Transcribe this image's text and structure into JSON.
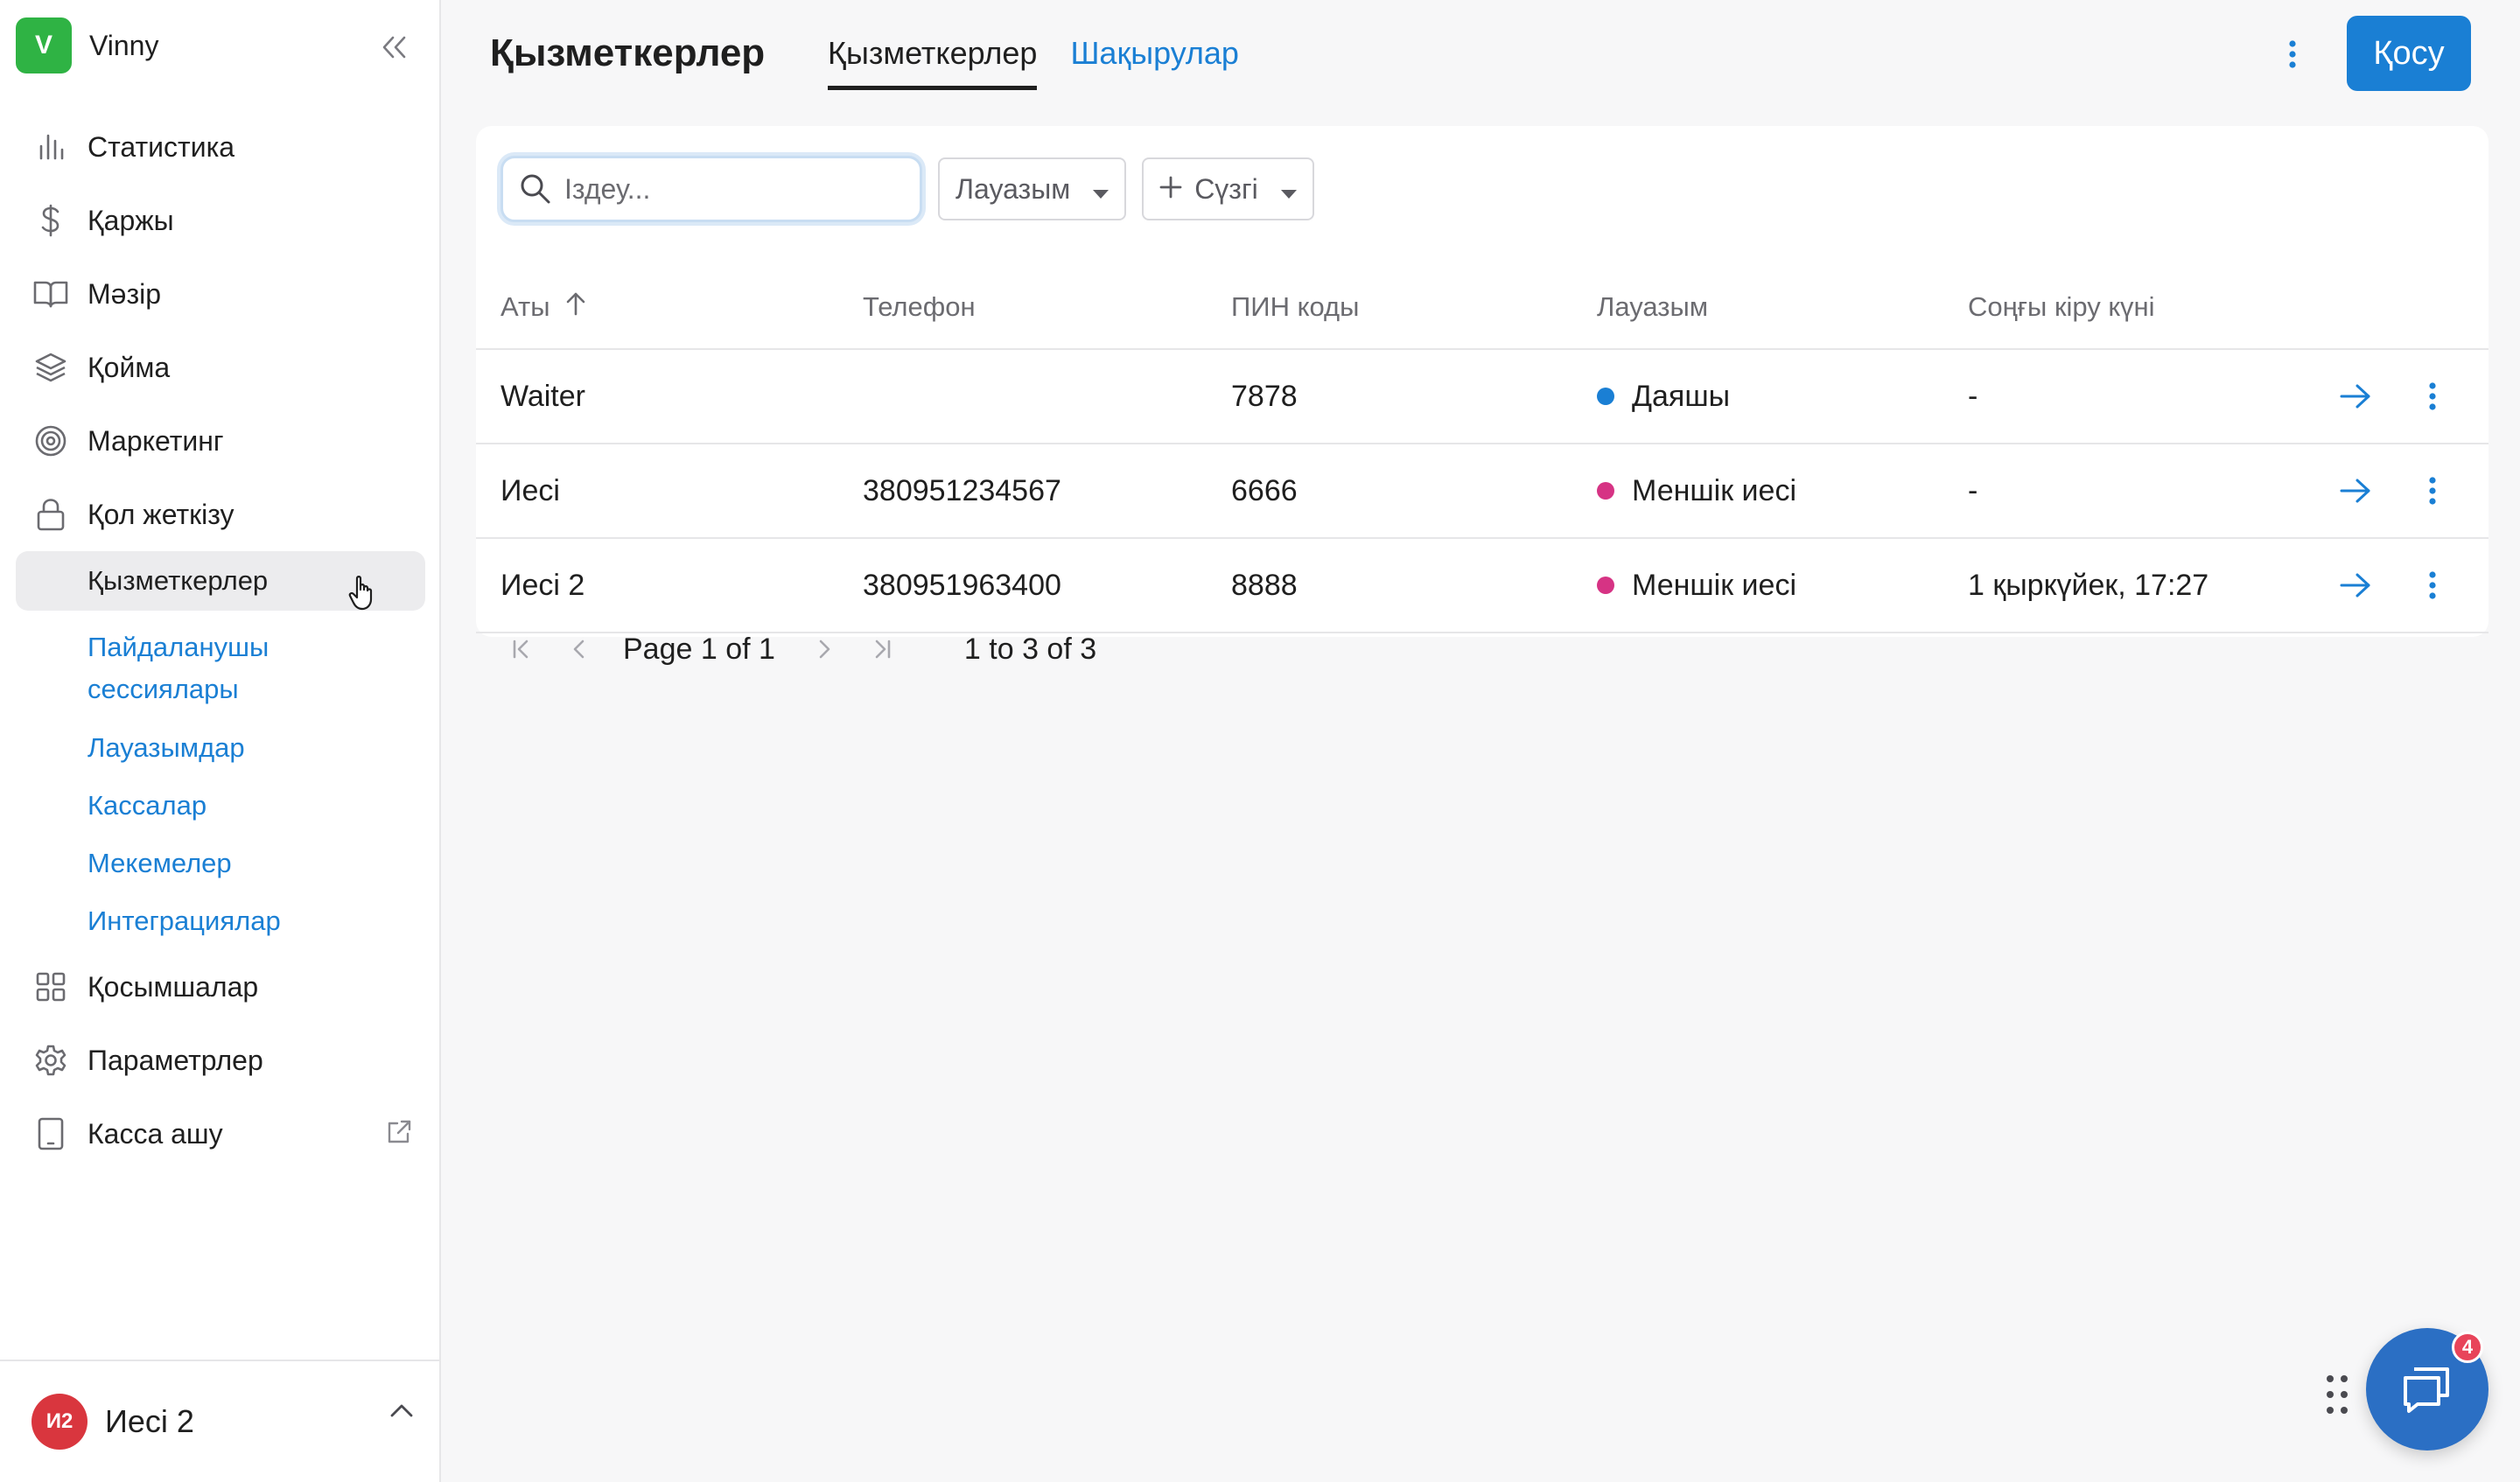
{
  "brand": {
    "initial": "V",
    "name": "Vinny"
  },
  "sidebar": {
    "items": [
      {
        "label": "Статистика",
        "icon": "bar-chart-icon"
      },
      {
        "label": "Қаржы",
        "icon": "dollar-icon"
      },
      {
        "label": "Мәзір",
        "icon": "book-icon"
      },
      {
        "label": "Қойма",
        "icon": "layers-icon"
      },
      {
        "label": "Маркетинг",
        "icon": "target-icon"
      },
      {
        "label": "Қол жеткізу",
        "icon": "lock-icon"
      }
    ],
    "subitems": [
      {
        "label": "Қызметкерлер",
        "active": true
      },
      {
        "label": "Пайдаланушы сессиялары"
      },
      {
        "label": "Лауазымдар"
      },
      {
        "label": "Кассалар"
      },
      {
        "label": "Мекемелер"
      },
      {
        "label": "Интеграциялар"
      }
    ],
    "bottom_items": [
      {
        "label": "Қосымшалар",
        "icon": "grid-icon"
      },
      {
        "label": "Параметрлер",
        "icon": "gear-icon"
      },
      {
        "label": "Касса ашу",
        "icon": "tablet-icon",
        "external": true
      }
    ]
  },
  "user": {
    "initials": "И2",
    "name": "Иесі 2",
    "avatar_color": "#d9363e"
  },
  "header": {
    "title": "Қызметкерлер",
    "tabs": [
      "Қызметкерлер",
      "Шақырулар"
    ],
    "add_label": "Қосу"
  },
  "toolbar": {
    "search_placeholder": "Іздеу...",
    "role_filter_label": "Лауазым",
    "add_filter_label": "Сүзгі"
  },
  "table": {
    "columns": [
      "Аты",
      "Телефон",
      "ПИН коды",
      "Лауазым",
      "Соңғы кіру күні"
    ],
    "rows": [
      {
        "name": "Waiter",
        "phone": "",
        "pin": "7878",
        "role": "Даяшы",
        "role_color": "#1a7fd4",
        "last_login": "-"
      },
      {
        "name": "Иесі",
        "phone": "380951234567",
        "pin": "6666",
        "role": "Меншік иесі",
        "role_color": "#d63384",
        "last_login": "-"
      },
      {
        "name": "Иесі 2",
        "phone": "380951963400",
        "pin": "8888",
        "role": "Меншік иесі",
        "role_color": "#d63384",
        "last_login": "1 қыркүйек, 17:27"
      }
    ]
  },
  "pagination": {
    "page_text": "Page 1 of 1",
    "count_text": "1 to 3 of 3"
  },
  "chat": {
    "badge": "4"
  },
  "colors": {
    "accent": "#1a7fd4",
    "brand": "#2fb344",
    "owner_role": "#d63384"
  }
}
